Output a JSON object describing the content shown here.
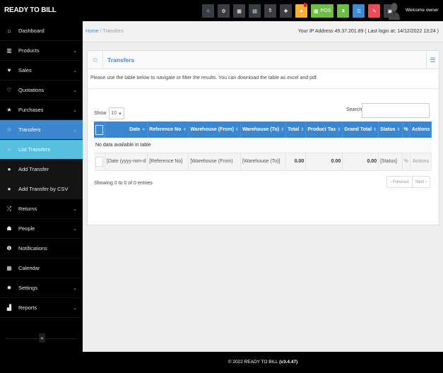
{
  "app": {
    "brand": "READY TO BILL",
    "welcome": "Welcome owner"
  },
  "toolbar": {
    "buttons": [
      {
        "icon": "home-icon",
        "glyph": "⌂",
        "color": "#3a3d41"
      },
      {
        "icon": "cogs-icon",
        "glyph": "⚙",
        "color": "#3a3d41"
      },
      {
        "icon": "calculator-icon",
        "glyph": "▦",
        "color": "#3a3d41"
      },
      {
        "icon": "calendar-icon",
        "glyph": "▤",
        "color": "#3a3d41"
      },
      {
        "icon": "html5-icon",
        "glyph": "5",
        "color": "#3a3d41"
      },
      {
        "icon": "language-flag-icon",
        "glyph": "✚",
        "color": "#3a3d41"
      },
      {
        "icon": "alerts-icon",
        "glyph": "▲",
        "color": "#f8b133",
        "badge": true
      },
      {
        "icon": "pos-icon",
        "glyph": "▦",
        "label": "POS",
        "color": "#6bc043"
      },
      {
        "icon": "hourglass-icon",
        "glyph": "⧗",
        "color": "#6bc043"
      },
      {
        "icon": "list-icon",
        "glyph": "☰",
        "color": "#3d8bd4"
      },
      {
        "icon": "eraser-icon",
        "glyph": "✎",
        "color": "#ee4c54"
      },
      {
        "icon": "window-icon",
        "glyph": "▣",
        "color": "#3a3d41"
      }
    ]
  },
  "sidebar": {
    "items": [
      {
        "label": "Dashboard",
        "icon": "dashboard-icon",
        "glyph": "⌂",
        "chevron": false,
        "state": ""
      },
      {
        "label": "Products",
        "icon": "barcode-icon",
        "glyph": "▥",
        "chevron": true,
        "state": ""
      },
      {
        "label": "Sales",
        "icon": "heart-icon",
        "glyph": "♥",
        "chevron": true,
        "state": ""
      },
      {
        "label": "Quotations",
        "icon": "heart-outline-icon",
        "glyph": "♡",
        "chevron": true,
        "state": ""
      },
      {
        "label": "Purchases",
        "icon": "star-icon",
        "glyph": "★",
        "chevron": true,
        "state": ""
      },
      {
        "label": "Transfers",
        "icon": "star-outline-icon",
        "glyph": "☆",
        "chevron": true,
        "state": "active"
      },
      {
        "label": "List Transfers",
        "icon": "star-outline-icon",
        "glyph": "☆",
        "chevron": false,
        "state": "sub-active"
      },
      {
        "label": "Add Transfer",
        "icon": "plus-circle-icon",
        "glyph": "●",
        "chevron": false,
        "state": "sub"
      },
      {
        "label": "Add Transfer by CSV",
        "icon": "plus-circle-icon",
        "glyph": "●",
        "chevron": false,
        "state": "sub"
      },
      {
        "label": "Returns",
        "icon": "random-icon",
        "glyph": "⤮",
        "chevron": true,
        "state": ""
      },
      {
        "label": "People",
        "icon": "users-icon",
        "glyph": "☗",
        "chevron": true,
        "state": ""
      },
      {
        "label": "Notifications",
        "icon": "info-circle-icon",
        "glyph": "❶",
        "chevron": false,
        "state": ""
      },
      {
        "label": "Calendar",
        "icon": "calendar-icon",
        "glyph": "▦",
        "chevron": false,
        "state": ""
      },
      {
        "label": "Settings",
        "icon": "cog-icon",
        "glyph": "✹",
        "chevron": true,
        "state": ""
      },
      {
        "label": "Reports",
        "icon": "bar-chart-icon",
        "glyph": "▟",
        "chevron": true,
        "state": ""
      }
    ],
    "collapse_glyph": "«"
  },
  "breadcrumb": {
    "home": "Home",
    "separator": "/",
    "current": "Transfers"
  },
  "ip_info": "Your IP Address 49.37.201.89 ( Last login at: 14/12/2022 13:24 )",
  "panel": {
    "title": "Transfers",
    "intro": "Please use the table below to navigate or filter the results. You can download the table as excel and pdf.",
    "show_label": "Show",
    "page_size": "10",
    "search_label": "Search",
    "search_value": ""
  },
  "table": {
    "columns": [
      {
        "label": "Date",
        "sort": "▼"
      },
      {
        "label": "Reference No",
        "sort": "▼"
      },
      {
        "label": "Warehouse (From)",
        "sort": "⇕"
      },
      {
        "label": "Warehouse (To)",
        "sort": "⇕"
      },
      {
        "label": "Total",
        "sort": "⇕"
      },
      {
        "label": "Product Tax",
        "sort": "⇕"
      },
      {
        "label": "Grand Total",
        "sort": "⇕"
      },
      {
        "label": "Status",
        "sort": "⇕"
      },
      {
        "label": "%",
        "sort": ""
      },
      {
        "label": "Actions",
        "sort": ""
      }
    ],
    "empty_message": "No data available in table",
    "footer": [
      "[Date (yyyy-mm-d",
      "[Reference No]",
      "[Warehouse (From)",
      "[Warehouse (To)]",
      "0.00",
      "0.00",
      "0.00",
      "[Status]",
      "%",
      "Actions"
    ],
    "info": "Showing 0 to 0 of 0 entries",
    "pager": {
      "prev": "‹ Previous",
      "next": "Next ›"
    }
  },
  "footer": {
    "text": "© 2022 READY TO BILL",
    "version": "(v3.4.47)"
  }
}
